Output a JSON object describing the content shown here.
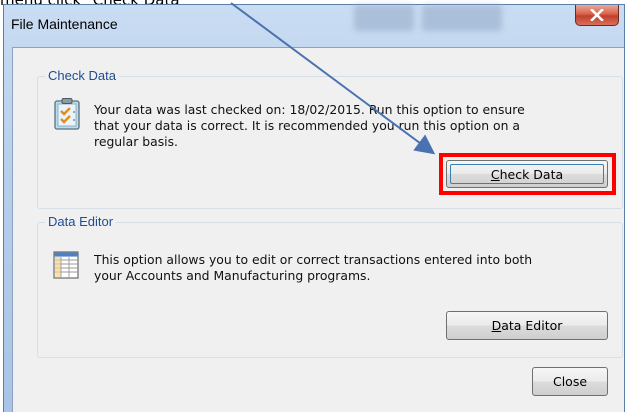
{
  "caption": {
    "text": "menu click \"Check Data\""
  },
  "window": {
    "title": "File Maintenance",
    "close_glyph": "✕"
  },
  "check_data": {
    "legend": "Check Data",
    "text_lines": [
      "Your data was last checked on: 18/02/2015.  Run this option to ensure",
      "that your data is correct.  It is recommended you run this option on a",
      "regular basis."
    ],
    "button_first": "C",
    "button_rest": "heck Data",
    "icon": "clipboard-check-icon"
  },
  "data_editor": {
    "legend": "Data Editor",
    "text_lines": [
      "This option allows you to edit or correct transactions entered into both",
      "your Accounts and Manufacturing programs."
    ],
    "button_first": "D",
    "button_rest": "ata Editor",
    "icon": "spreadsheet-icon"
  },
  "footer": {
    "close_label": "Close"
  },
  "annotation": {
    "highlight_color": "#ff0000",
    "arrow_color": "#4a72b0"
  }
}
